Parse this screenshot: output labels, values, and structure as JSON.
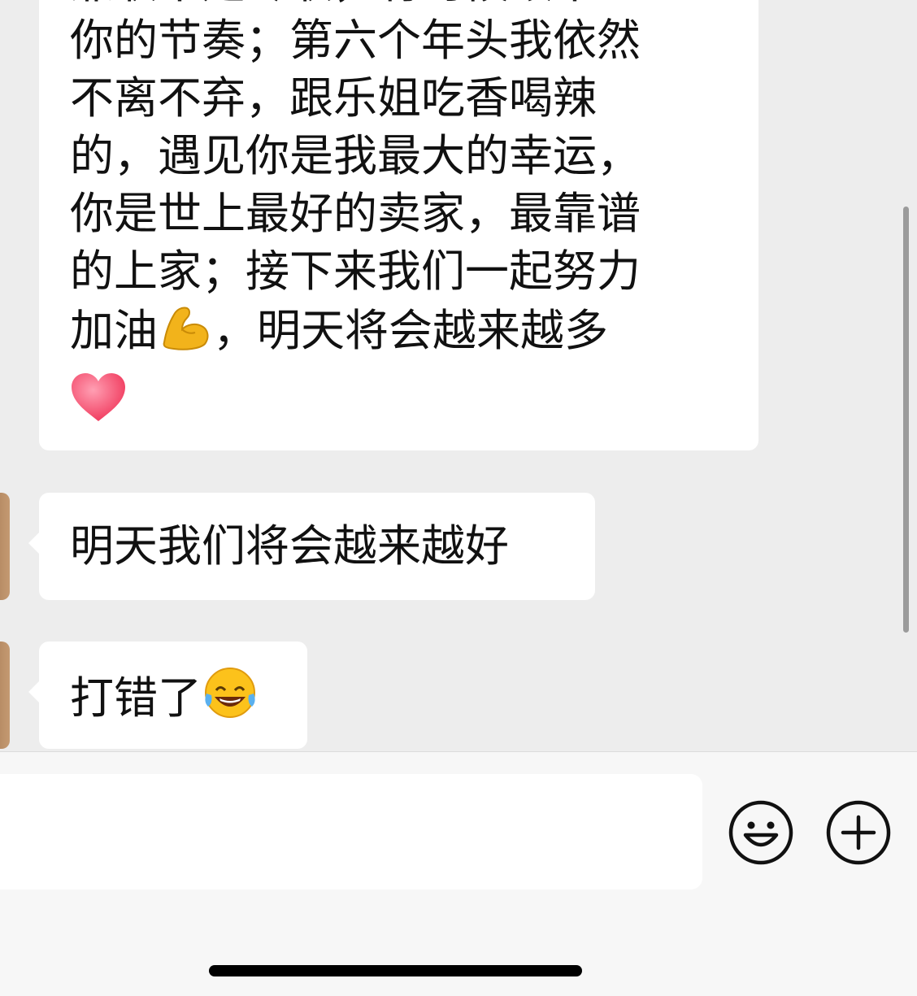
{
  "chat": {
    "messages": [
      {
        "lines": [
          "兼职不是专职，有时候跟不上",
          "你的节奏；第六个年头我依然",
          "不离不弃，跟乐姐吃香喝辣",
          "的，遇见你是我最大的幸运，",
          "你是世上最好的卖家，最靠谱",
          "的上家；接下来我们一起努力",
          "加油",
          "，明天将会越来越多"
        ],
        "emoji_after_line": "flexed-biceps-icon",
        "trailing_emoji": "heart-icon"
      },
      {
        "text": "明天我们将会越来越好"
      },
      {
        "text": "打错了",
        "emoji": "face-with-tears-of-joy-icon"
      }
    ]
  },
  "input": {
    "value": "",
    "placeholder": ""
  },
  "toolbar": {
    "emoji_icon": "smiley-icon",
    "plus_icon": "plus-circle-icon"
  },
  "colors": {
    "background": "#ededed",
    "bubble": "#ffffff",
    "text": "#111111",
    "input_bar": "#f7f7f7"
  }
}
